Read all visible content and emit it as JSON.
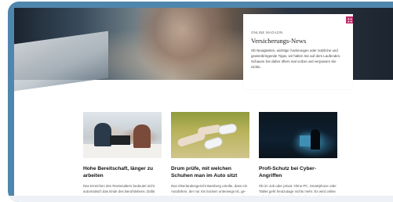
{
  "hero": {
    "card": {
      "eyebrow": "ONLINE MAGAZIN",
      "title": "Versicherungs-News",
      "text": "Ob Neuigkeiten, wichtige Änderungen oder nützliche und gewinnbringende Tipps, wir halten Sie auf dem Laufenden. Schauen Sie daher öfters mal vorbei und verpassen Sie nichts.",
      "badge_icon": "grid-icon",
      "badge_color": "#c0306a"
    }
  },
  "articles": [
    {
      "title": "Hohe Bereitschaft, länger zu arbeiten",
      "text": "Das Erreichen des Rentenalters bedeutet nicht automatisch das Ende des Berufslebens. Dafür spr-"
    },
    {
      "title": "Drum prüfe, mit welchen Schuhen man im Auto sitzt",
      "text": "Das Oberlandesgericht Bamberg urteilte, dass ein Autofahrer, der nur mit Socken unterwegs ist, ge-"
    },
    {
      "title": "Profi-Schutz bei Cyber-Angriffen",
      "text": "Ob im Job oder privat: Ohne PC, Smartphone oder Tablet geht heutzutage nichts mehr. Es wird online gekauft, gearbeitet, informiert, kommuniziert etc. Zu-"
    }
  ],
  "colors": {
    "frame": "#4f86ad",
    "accent": "#c0306a"
  }
}
